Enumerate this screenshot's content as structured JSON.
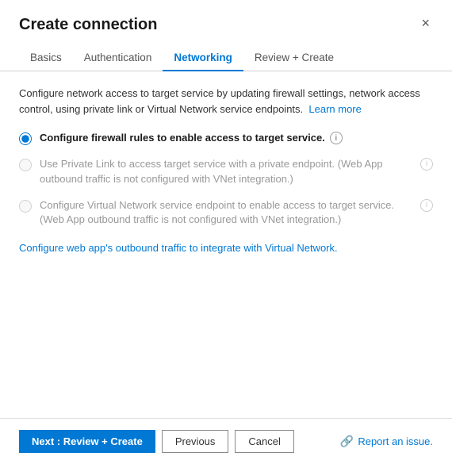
{
  "dialog": {
    "title": "Create connection",
    "close_label": "×"
  },
  "tabs": [
    {
      "id": "basics",
      "label": "Basics",
      "active": false
    },
    {
      "id": "authentication",
      "label": "Authentication",
      "active": false
    },
    {
      "id": "networking",
      "label": "Networking",
      "active": true
    },
    {
      "id": "review-create",
      "label": "Review + Create",
      "active": false
    }
  ],
  "description": "Configure network access to target service by updating firewall settings, network access control, using private link or Virtual Network service endpoints.",
  "learn_more": "Learn more",
  "radio_options": [
    {
      "id": "firewall",
      "label": "Configure firewall rules to enable access to target service.",
      "bold": true,
      "disabled": false,
      "selected": true,
      "info": true
    },
    {
      "id": "private-link",
      "label": "Use Private Link to access target service with a private endpoint. (Web App outbound traffic is not configured with VNet integration.)",
      "bold": false,
      "disabled": true,
      "selected": false,
      "info": true
    },
    {
      "id": "vnet-endpoint",
      "label": "Configure Virtual Network service endpoint to enable access to target service. (Web App outbound traffic is not configured with VNet integration.)",
      "bold": false,
      "disabled": true,
      "selected": false,
      "info": true
    }
  ],
  "vnet_link_text": "Configure web app's outbound traffic to integrate with Virtual Network.",
  "footer": {
    "next_label": "Next : Review + Create",
    "previous_label": "Previous",
    "cancel_label": "Cancel",
    "report_label": "Report an issue."
  }
}
